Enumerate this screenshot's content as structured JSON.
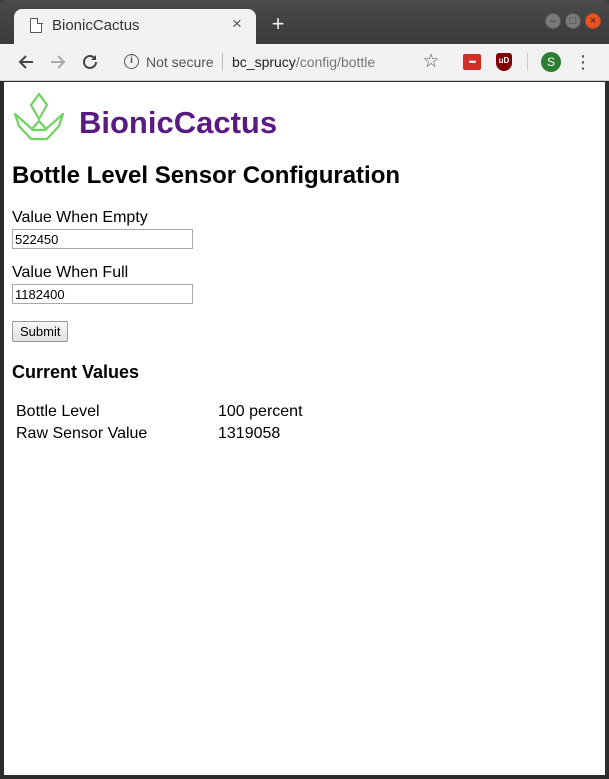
{
  "browser": {
    "tab_title": "BionicCactus",
    "security_text": "Not secure",
    "url_host": "bc_sprucy",
    "url_path": "/config/bottle",
    "avatar_initial": "S",
    "lastpass_glyph": "•••",
    "ublock_glyph": "uD"
  },
  "page": {
    "brand": "BionicCactus",
    "title": "Bottle Level Sensor Configuration",
    "form": {
      "empty_label": "Value When Empty",
      "empty_value": "522450",
      "full_label": "Value When Full",
      "full_value": "1182400",
      "submit_label": "Submit"
    },
    "current": {
      "heading": "Current Values",
      "rows": [
        {
          "label": "Bottle Level",
          "value": "100 percent"
        },
        {
          "label": "Raw Sensor Value",
          "value": "1319058"
        }
      ]
    }
  },
  "colors": {
    "brand": "#5a1a82",
    "logo": "#6fd35f"
  },
  "icons": {
    "back": "arrow-left-icon",
    "forward": "arrow-right-icon",
    "reload": "reload-icon",
    "info": "info-icon",
    "bookmark": "star-icon",
    "menu": "kebab-menu-icon"
  }
}
